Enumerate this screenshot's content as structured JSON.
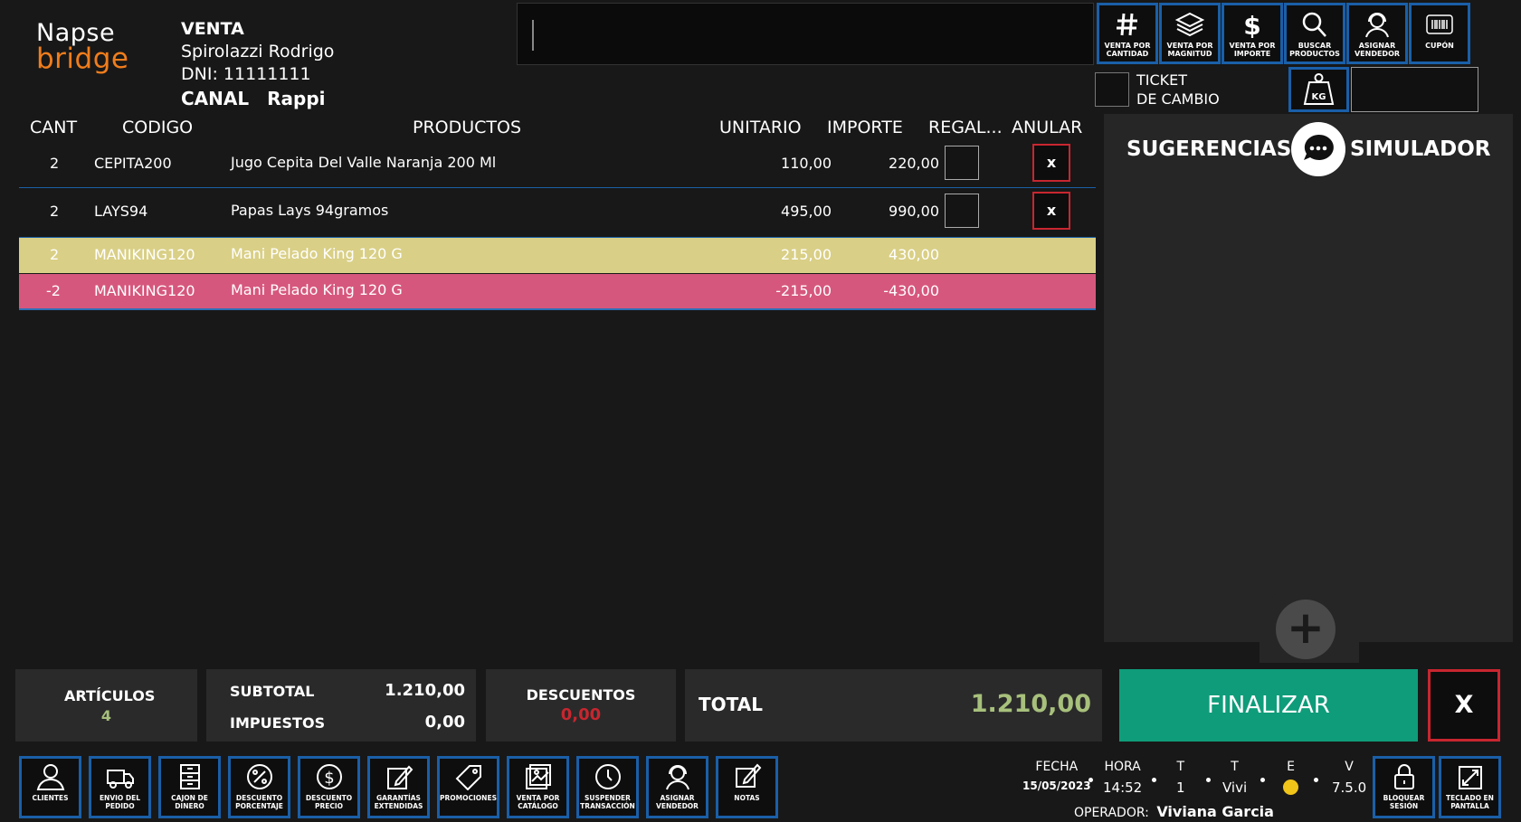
{
  "brand": {
    "line1": "Napse",
    "line2": "bridge",
    "accent": "#f07d1c"
  },
  "sale": {
    "title": "VENTA",
    "customer": "Spirolazzi Rodrigo",
    "dni": "DNI: 11111111",
    "channel_label": "CANAL",
    "channel_value": "Rappi"
  },
  "search": {
    "value": "",
    "placeholder": ""
  },
  "top_buttons": [
    {
      "label": "VENTA POR CANTIDAD",
      "icon": "hash-icon"
    },
    {
      "label": "VENTA POR MAGNITUD",
      "icon": "layers-icon"
    },
    {
      "label": "VENTA POR IMPORTE",
      "icon": "dollar-icon"
    },
    {
      "label": "BUSCAR PRODUCTOS",
      "icon": "search-icon"
    },
    {
      "label": "ASIGNAR VENDEDOR",
      "icon": "agent-icon"
    },
    {
      "label": "CUPÓN",
      "icon": "barcode-icon"
    }
  ],
  "ticket_cambio": {
    "line1": "TICKET",
    "line2": "DE CAMBIO"
  },
  "table": {
    "headers": {
      "cant": "CANT",
      "codigo": "CODIGO",
      "productos": "PRODUCTOS",
      "unitario": "UNITARIO",
      "importe": "IMPORTE",
      "regalo": "REGAL...",
      "anular": "ANULAR"
    },
    "rows": [
      {
        "cant": "2",
        "codigo": "CEPITA200",
        "producto": "Jugo Cepita Del Valle Naranja 200 Ml",
        "unitario": "110,00",
        "importe": "220,00",
        "anular": "x"
      },
      {
        "cant": "2",
        "codigo": "LAYS94",
        "producto": "Papas Lays 94gramos",
        "unitario": "495,00",
        "importe": "990,00",
        "anular": "x"
      },
      {
        "cant": "2",
        "codigo": "MANIKING120",
        "producto": "Mani Pelado King 120 G",
        "unitario": "215,00",
        "importe": "430,00"
      },
      {
        "cant": "-2",
        "codigo": "MANIKING120",
        "producto": "Mani Pelado King 120 G",
        "unitario": "-215,00",
        "importe": "-430,00"
      }
    ]
  },
  "panel": {
    "left": "SUGERENCIAS",
    "right": "SIMULADOR"
  },
  "totals": {
    "articulos_label": "ARTÍCULOS",
    "articulos_value": "4",
    "subtotal_label": "SUBTOTAL",
    "subtotal_value": "1.210,00",
    "impuestos_label": "IMPUESTOS",
    "impuestos_value": "0,00",
    "descuentos_label": "DESCUENTOS",
    "descuentos_value": "0,00",
    "total_label": "TOTAL",
    "total_value": "1.210,00"
  },
  "actions": {
    "finalizar": "FINALIZAR",
    "cancel": "X"
  },
  "bottom_buttons": [
    {
      "label": "CLIENTES",
      "icon": "user-icon"
    },
    {
      "label": "ENVIO DEL PEDIDO",
      "icon": "truck-icon"
    },
    {
      "label": "CAJON DE DINERO",
      "icon": "drawer-icon"
    },
    {
      "label": "DESCUENTO PORCENTAJE",
      "icon": "percent-icon"
    },
    {
      "label": "DESCUENTO PRECIO",
      "icon": "price-discount-icon"
    },
    {
      "label": "GARANTÍAS EXTENDIDAS",
      "icon": "edit-icon"
    },
    {
      "label": "PROMOCIONES",
      "icon": "tag-icon"
    },
    {
      "label": "VENTA POR CATÁLOGO",
      "icon": "catalog-icon"
    },
    {
      "label": "SUSPENDER TRANSACCIÓN",
      "icon": "clock-icon"
    },
    {
      "label": "ASIGNAR VENDEDOR",
      "icon": "agent-icon"
    },
    {
      "label": "NOTAS",
      "icon": "note-icon"
    }
  ],
  "status": {
    "fecha_label": "FECHA",
    "fecha_value": "15/05/2023",
    "hora_label": "HORA",
    "hora_value": "14:52",
    "t1_label": "T",
    "t1_value": "1",
    "t2_label": "T",
    "t2_value": "Vivi",
    "e_label": "E",
    "v_label": "V",
    "v_value": "7.5.0",
    "operador_label": "OPERADOR:",
    "operador_value": "Viviana Garcia"
  },
  "right_bottom_buttons": [
    {
      "label": "BLOQUEAR SESIÓN",
      "icon": "lock-icon"
    },
    {
      "label": "TECLADO EN PANTALLA",
      "icon": "keyboard-expand-icon"
    }
  ],
  "colors": {
    "button_border": "#1a5fa8",
    "highlight_yellow": "#d9cf86",
    "highlight_pink": "#d6577d",
    "finalizar_green": "#0f9c7a",
    "danger_red": "#c8262f",
    "total_green": "#a7c07c"
  }
}
